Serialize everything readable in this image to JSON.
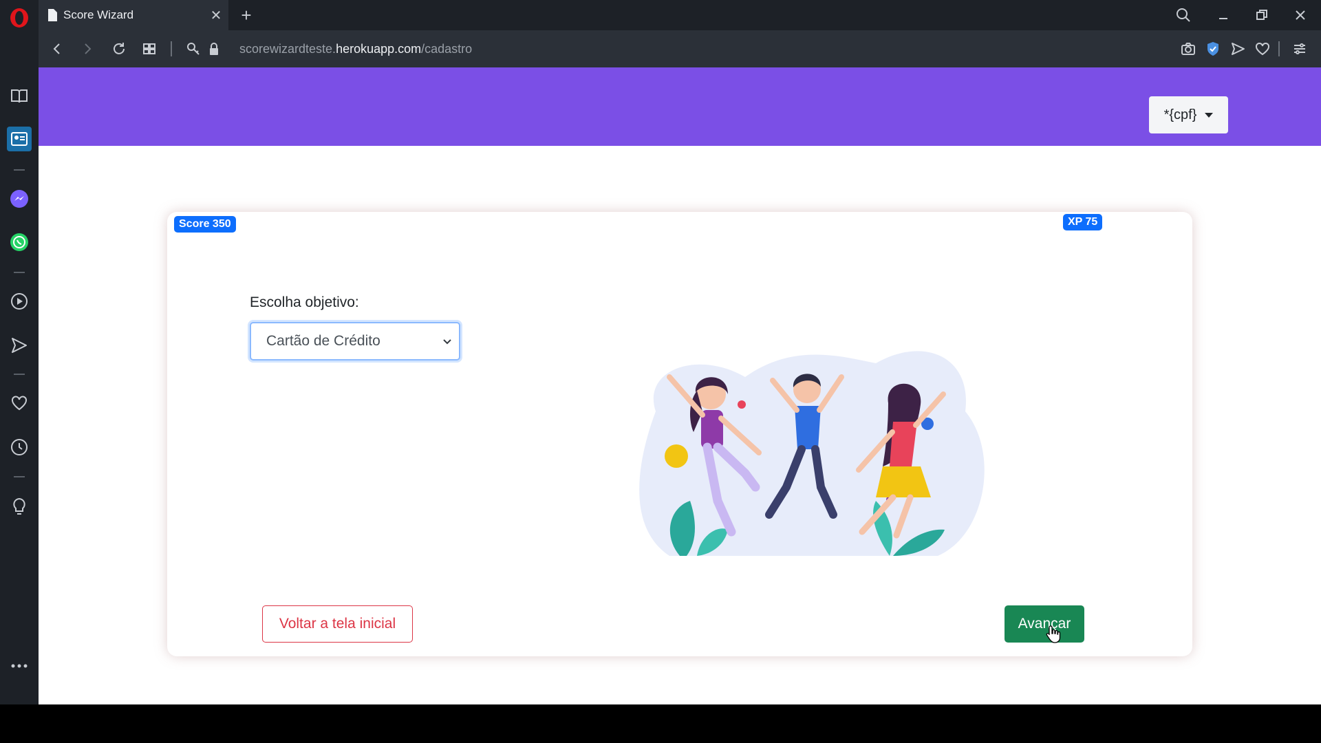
{
  "browser": {
    "tab_title": "Score Wizard",
    "tab_close": "✕",
    "new_tab": "+",
    "url_prefix": "scorewizardteste.",
    "url_host": "herokuapp.com",
    "url_path": "/cadastro"
  },
  "header": {
    "cpf_label": "*{cpf}"
  },
  "card": {
    "score_badge": "Score 350",
    "xp_badge": "XP 75",
    "objective_label": "Escolha objetivo:",
    "objective_selected": "Cartão de Crédito",
    "back_button": "Voltar a tela inicial",
    "next_button": "Avançar"
  },
  "colors": {
    "header_purple": "#7b4fe6",
    "badge_blue": "#0d6efd",
    "success_green": "#198754",
    "danger_red": "#dc3545",
    "opera_red": "#e0151b"
  }
}
